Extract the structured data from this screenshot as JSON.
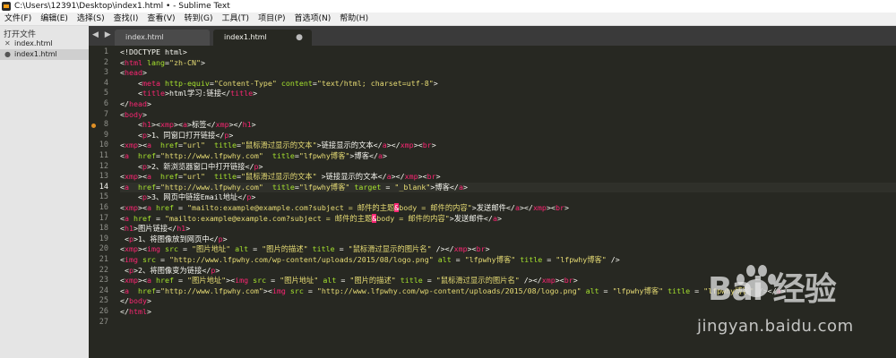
{
  "window": {
    "title": "C:\\Users\\12391\\Desktop\\index1.html • - Sublime Text"
  },
  "menu": [
    "文件(F)",
    "编辑(E)",
    "选择(S)",
    "查找(I)",
    "查看(V)",
    "转到(G)",
    "工具(T)",
    "项目(P)",
    "首选项(N)",
    "帮助(H)"
  ],
  "sidebar": {
    "heading": "打开文件",
    "files": [
      {
        "name": "index.html",
        "icon": "✕",
        "active": false
      },
      {
        "name": "index1.html",
        "icon": "●",
        "active": true
      }
    ]
  },
  "nav": {
    "arrows": "◀ ▶"
  },
  "tabs": [
    {
      "label": "index.html",
      "active": false
    },
    {
      "label": "index1.html",
      "active": true,
      "modified_dot": "●"
    }
  ],
  "editor": {
    "current_line": 14,
    "marker_line": 8,
    "lines": [
      [
        [
          "<!DOCTYPE html>",
          "#f8f8f2"
        ]
      ],
      [
        [
          "<",
          "#f8f8f2"
        ],
        [
          "html",
          "#f92672"
        ],
        [
          " lang",
          "#a6e22e"
        ],
        [
          "=",
          "#f8f8f2"
        ],
        [
          "\"zh-CN\"",
          "#e6db74"
        ],
        [
          ">",
          "#f8f8f2"
        ]
      ],
      [
        [
          "<",
          "#f8f8f2"
        ],
        [
          "head",
          "#f92672"
        ],
        [
          ">",
          "#f8f8f2"
        ]
      ],
      [
        [
          "    <",
          "#f8f8f2"
        ],
        [
          "meta",
          "#f92672"
        ],
        [
          " http-equiv",
          "#a6e22e"
        ],
        [
          "=",
          "#f8f8f2"
        ],
        [
          "\"Content-Type\"",
          "#e6db74"
        ],
        [
          " content",
          "#a6e22e"
        ],
        [
          "=",
          "#f8f8f2"
        ],
        [
          "\"text/html; charset=utf-8\"",
          "#e6db74"
        ],
        [
          ">",
          "#f8f8f2"
        ]
      ],
      [
        [
          "    <",
          "#f8f8f2"
        ],
        [
          "title",
          "#f92672"
        ],
        [
          ">html学习:链接</",
          "#f8f8f2"
        ],
        [
          "title",
          "#f92672"
        ],
        [
          ">",
          "#f8f8f2"
        ]
      ],
      [
        [
          "</",
          "#f8f8f2"
        ],
        [
          "head",
          "#f92672"
        ],
        [
          ">",
          "#f8f8f2"
        ]
      ],
      [
        [
          "<",
          "#f8f8f2"
        ],
        [
          "body",
          "#f92672"
        ],
        [
          ">",
          "#f8f8f2"
        ]
      ],
      [
        [
          "    <",
          "#f8f8f2"
        ],
        [
          "h1",
          "#f92672"
        ],
        [
          "><",
          "#f8f8f2"
        ],
        [
          "xmp",
          "#f92672"
        ],
        [
          "><",
          "#f8f8f2"
        ],
        [
          "a",
          "#f92672"
        ],
        [
          ">标签</",
          "#f8f8f2"
        ],
        [
          "xmp",
          "#f92672"
        ],
        [
          "></",
          "#f8f8f2"
        ],
        [
          "h1",
          "#f92672"
        ],
        [
          ">",
          "#f8f8f2"
        ]
      ],
      [
        [
          "    <",
          "#f8f8f2"
        ],
        [
          "p",
          "#f92672"
        ],
        [
          ">1、同窗口打开链接</",
          "#f8f8f2"
        ],
        [
          "p",
          "#f92672"
        ],
        [
          ">",
          "#f8f8f2"
        ]
      ],
      [
        [
          "<",
          "#f8f8f2"
        ],
        [
          "xmp",
          "#f92672"
        ],
        [
          "><",
          "#f8f8f2"
        ],
        [
          "a",
          "#f92672"
        ],
        [
          "  href",
          "#a6e22e"
        ],
        [
          "=",
          "#f8f8f2"
        ],
        [
          "\"url\"",
          "#e6db74"
        ],
        [
          "  title",
          "#a6e22e"
        ],
        [
          "=",
          "#f8f8f2"
        ],
        [
          "\"鼠标滑过显示的文本\"",
          "#e6db74"
        ],
        [
          ">链接显示的文本</",
          "#f8f8f2"
        ],
        [
          "a",
          "#f92672"
        ],
        [
          "></",
          "#f8f8f2"
        ],
        [
          "xmp",
          "#f92672"
        ],
        [
          "><",
          "#f8f8f2"
        ],
        [
          "br",
          "#f92672"
        ],
        [
          ">",
          "#f8f8f2"
        ]
      ],
      [
        [
          "<",
          "#f8f8f2"
        ],
        [
          "a",
          "#f92672"
        ],
        [
          "  href",
          "#a6e22e"
        ],
        [
          "=",
          "#f8f8f2"
        ],
        [
          "\"http://www.lfpwhy.com\"",
          "#e6db74"
        ],
        [
          "  title",
          "#a6e22e"
        ],
        [
          "=",
          "#f8f8f2"
        ],
        [
          "\"lfpwhy博客\"",
          "#e6db74"
        ],
        [
          ">博客</",
          "#f8f8f2"
        ],
        [
          "a",
          "#f92672"
        ],
        [
          ">",
          "#f8f8f2"
        ]
      ],
      [
        [
          "    <",
          "#f8f8f2"
        ],
        [
          "p",
          "#f92672"
        ],
        [
          ">2、新浏览器窗口中打开链接</",
          "#f8f8f2"
        ],
        [
          "p",
          "#f92672"
        ],
        [
          ">",
          "#f8f8f2"
        ]
      ],
      [
        [
          "<",
          "#f8f8f2"
        ],
        [
          "xmp",
          "#f92672"
        ],
        [
          "><",
          "#f8f8f2"
        ],
        [
          "a",
          "#f92672"
        ],
        [
          "  href",
          "#a6e22e"
        ],
        [
          "=",
          "#f8f8f2"
        ],
        [
          "\"url\"",
          "#e6db74"
        ],
        [
          "  title",
          "#a6e22e"
        ],
        [
          "=",
          "#f8f8f2"
        ],
        [
          "\"鼠标滑过显示的文本\"",
          "#e6db74"
        ],
        [
          " >链接显示的文本</",
          "#f8f8f2"
        ],
        [
          "a",
          "#f92672"
        ],
        [
          "></",
          "#f8f8f2"
        ],
        [
          "xmp",
          "#f92672"
        ],
        [
          "><",
          "#f8f8f2"
        ],
        [
          "br",
          "#f92672"
        ],
        [
          ">",
          "#f8f8f2"
        ]
      ],
      [
        [
          "<",
          "#f8f8f2"
        ],
        [
          "a",
          "#f92672"
        ],
        [
          "  href",
          "#a6e22e"
        ],
        [
          "=",
          "#f8f8f2"
        ],
        [
          "\"http://www.lfpwhy.com\"",
          "#e6db74"
        ],
        [
          "  title",
          "#a6e22e"
        ],
        [
          "=",
          "#f8f8f2"
        ],
        [
          "\"lfpwhy博客\"",
          "#e6db74"
        ],
        [
          " target",
          "#a6e22e"
        ],
        [
          " = ",
          "#f8f8f2"
        ],
        [
          "\"_blank\"",
          "#e6db74"
        ],
        [
          ">博客</",
          "#f8f8f2"
        ],
        [
          "a",
          "#f92672"
        ],
        [
          ">",
          "#f8f8f2"
        ]
      ],
      [
        [
          "    <",
          "#f8f8f2"
        ],
        [
          "p",
          "#f92672"
        ],
        [
          ">3、网页中链接Email地址</",
          "#f8f8f2"
        ],
        [
          "p",
          "#f92672"
        ],
        [
          ">",
          "#f8f8f2"
        ]
      ],
      [
        [
          "<",
          "#f8f8f2"
        ],
        [
          "xmp",
          "#f92672"
        ],
        [
          "><",
          "#f8f8f2"
        ],
        [
          "a",
          "#f92672"
        ],
        [
          " href",
          "#a6e22e"
        ],
        [
          " = ",
          "#f8f8f2"
        ],
        [
          "\"mailto:example@example.com?subject = 邮件的主题",
          "#e6db74"
        ],
        [
          "&",
          "#ffffff",
          "#f92672"
        ],
        [
          "body = 邮件的内容\"",
          "#e6db74"
        ],
        [
          ">发送邮件</",
          "#f8f8f2"
        ],
        [
          "a",
          "#f92672"
        ],
        [
          "></",
          "#f8f8f2"
        ],
        [
          "xmp",
          "#f92672"
        ],
        [
          "><",
          "#f8f8f2"
        ],
        [
          "br",
          "#f92672"
        ],
        [
          ">",
          "#f8f8f2"
        ]
      ],
      [
        [
          "<",
          "#f8f8f2"
        ],
        [
          "a",
          "#f92672"
        ],
        [
          " href",
          "#a6e22e"
        ],
        [
          " = ",
          "#f8f8f2"
        ],
        [
          "\"mailto:example@example.com?subject = 邮件的主题",
          "#e6db74"
        ],
        [
          "&",
          "#ffffff",
          "#f92672"
        ],
        [
          "body = 邮件的内容\"",
          "#e6db74"
        ],
        [
          ">发送邮件</",
          "#f8f8f2"
        ],
        [
          "a",
          "#f92672"
        ],
        [
          ">",
          "#f8f8f2"
        ]
      ],
      [
        [
          "<",
          "#f8f8f2"
        ],
        [
          "h1",
          "#f92672"
        ],
        [
          ">图片链接</",
          "#f8f8f2"
        ],
        [
          "h1",
          "#f92672"
        ],
        [
          ">",
          "#f8f8f2"
        ]
      ],
      [
        [
          " <",
          "#f8f8f2"
        ],
        [
          "p",
          "#f92672"
        ],
        [
          ">1、将图像放到网页中</",
          "#f8f8f2"
        ],
        [
          "p",
          "#f92672"
        ],
        [
          ">",
          "#f8f8f2"
        ]
      ],
      [
        [
          "<",
          "#f8f8f2"
        ],
        [
          "xmp",
          "#f92672"
        ],
        [
          "><",
          "#f8f8f2"
        ],
        [
          "img",
          "#f92672"
        ],
        [
          " src",
          "#a6e22e"
        ],
        [
          " = ",
          "#f8f8f2"
        ],
        [
          "\"图片地址\"",
          "#e6db74"
        ],
        [
          " alt",
          "#a6e22e"
        ],
        [
          " = ",
          "#f8f8f2"
        ],
        [
          "\"图片的描述\"",
          "#e6db74"
        ],
        [
          " title",
          "#a6e22e"
        ],
        [
          " = ",
          "#f8f8f2"
        ],
        [
          "\"鼠标滑过显示的图片名\"",
          "#e6db74"
        ],
        [
          " /></",
          "#f8f8f2"
        ],
        [
          "xmp",
          "#f92672"
        ],
        [
          "><",
          "#f8f8f2"
        ],
        [
          "br",
          "#f92672"
        ],
        [
          ">",
          "#f8f8f2"
        ]
      ],
      [
        [
          "<",
          "#f8f8f2"
        ],
        [
          "img",
          "#f92672"
        ],
        [
          " src",
          "#a6e22e"
        ],
        [
          " = ",
          "#f8f8f2"
        ],
        [
          "\"http://www.lfpwhy.com/wp-content/uploads/2015/08/logo.png\"",
          "#e6db74"
        ],
        [
          " alt",
          "#a6e22e"
        ],
        [
          " = ",
          "#f8f8f2"
        ],
        [
          "\"lfpwhy博客\"",
          "#e6db74"
        ],
        [
          " title",
          "#a6e22e"
        ],
        [
          " = ",
          "#f8f8f2"
        ],
        [
          "\"lfpwhy博客\"",
          "#e6db74"
        ],
        [
          " />",
          "#f8f8f2"
        ]
      ],
      [
        [
          " <",
          "#f8f8f2"
        ],
        [
          "p",
          "#f92672"
        ],
        [
          ">2、将图像变为链接</",
          "#f8f8f2"
        ],
        [
          "p",
          "#f92672"
        ],
        [
          ">",
          "#f8f8f2"
        ]
      ],
      [
        [
          "<",
          "#f8f8f2"
        ],
        [
          "xmp",
          "#f92672"
        ],
        [
          "><",
          "#f8f8f2"
        ],
        [
          "a",
          "#f92672"
        ],
        [
          " href",
          "#a6e22e"
        ],
        [
          " = ",
          "#f8f8f2"
        ],
        [
          "\"图片地址\"",
          "#e6db74"
        ],
        [
          "><",
          "#f8f8f2"
        ],
        [
          "img",
          "#f92672"
        ],
        [
          " src",
          "#a6e22e"
        ],
        [
          " = ",
          "#f8f8f2"
        ],
        [
          "\"图片地址\"",
          "#e6db74"
        ],
        [
          " alt",
          "#a6e22e"
        ],
        [
          " = ",
          "#f8f8f2"
        ],
        [
          "\"图片的描述\"",
          "#e6db74"
        ],
        [
          " title",
          "#a6e22e"
        ],
        [
          " = ",
          "#f8f8f2"
        ],
        [
          "\"鼠标滑过显示的图片名\"",
          "#e6db74"
        ],
        [
          " /></",
          "#f8f8f2"
        ],
        [
          "xmp",
          "#f92672"
        ],
        [
          "><",
          "#f8f8f2"
        ],
        [
          "br",
          "#f92672"
        ],
        [
          ">",
          "#f8f8f2"
        ]
      ],
      [
        [
          "<",
          "#f8f8f2"
        ],
        [
          "a",
          "#f92672"
        ],
        [
          "  href",
          "#a6e22e"
        ],
        [
          "=",
          "#f8f8f2"
        ],
        [
          "\"http://www.lfpwhy.com\"",
          "#e6db74"
        ],
        [
          "><",
          "#f8f8f2"
        ],
        [
          "img",
          "#f92672"
        ],
        [
          " src",
          "#a6e22e"
        ],
        [
          " = ",
          "#f8f8f2"
        ],
        [
          "\"http://www.lfpwhy.com/wp-content/uploads/2015/08/logo.png\"",
          "#e6db74"
        ],
        [
          " alt",
          "#a6e22e"
        ],
        [
          " = ",
          "#f8f8f2"
        ],
        [
          "\"lfpwhy博客\"",
          "#e6db74"
        ],
        [
          " title",
          "#a6e22e"
        ],
        [
          " = ",
          "#f8f8f2"
        ],
        [
          "\"lfpwhy博客\"",
          "#e6db74"
        ],
        [
          " /></",
          "#f8f8f2"
        ],
        [
          "a",
          "#f92672"
        ],
        [
          ">",
          "#f8f8f2"
        ]
      ],
      [
        [
          "</",
          "#f8f8f2"
        ],
        [
          "body",
          "#f92672"
        ],
        [
          ">",
          "#f8f8f2"
        ]
      ],
      [
        [
          "</",
          "#f8f8f2"
        ],
        [
          "html",
          "#f92672"
        ],
        [
          ">",
          "#f8f8f2"
        ]
      ],
      []
    ]
  },
  "watermark": {
    "logo": "Bai 经验",
    "url": "jingyan.baidu.com"
  }
}
